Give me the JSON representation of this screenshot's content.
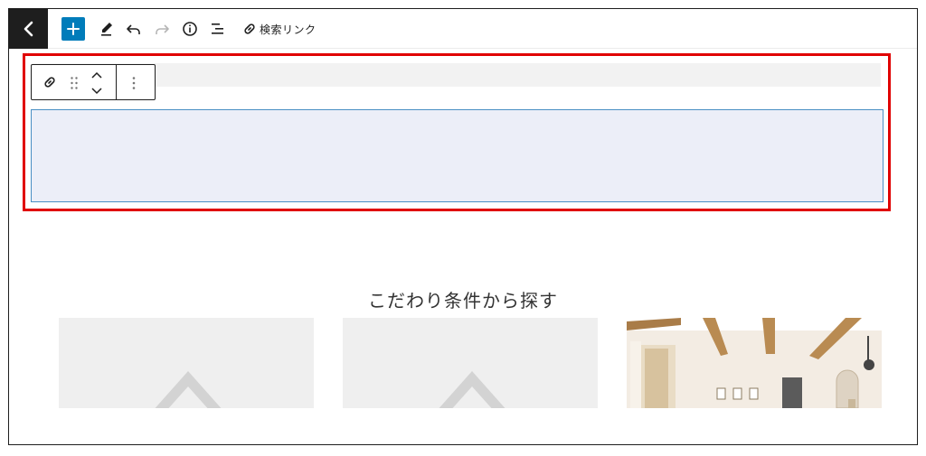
{
  "toolbar": {
    "back_icon": "chevron-left-icon",
    "add_icon": "plus-icon",
    "edit_icon": "pencil-icon",
    "undo_icon": "undo-icon",
    "redo_icon": "redo-icon",
    "info_icon": "info-icon",
    "outline_icon": "list-view-icon",
    "link_icon": "link-icon",
    "link_label": "検索リンク",
    "accent_color": "#007cba"
  },
  "block_toolbar": {
    "link_icon": "link-icon",
    "drag_icon": "drag-handle-icon",
    "move_icon": "chevron-up-down-icon",
    "more_icon": "more-vertical-icon"
  },
  "highlight_color": "#e00000",
  "section": {
    "title": "こだわり条件から探す"
  },
  "cards": [
    {
      "kind": "placeholder-house-icon"
    },
    {
      "kind": "placeholder-house-icon"
    },
    {
      "kind": "interior-photo"
    }
  ]
}
